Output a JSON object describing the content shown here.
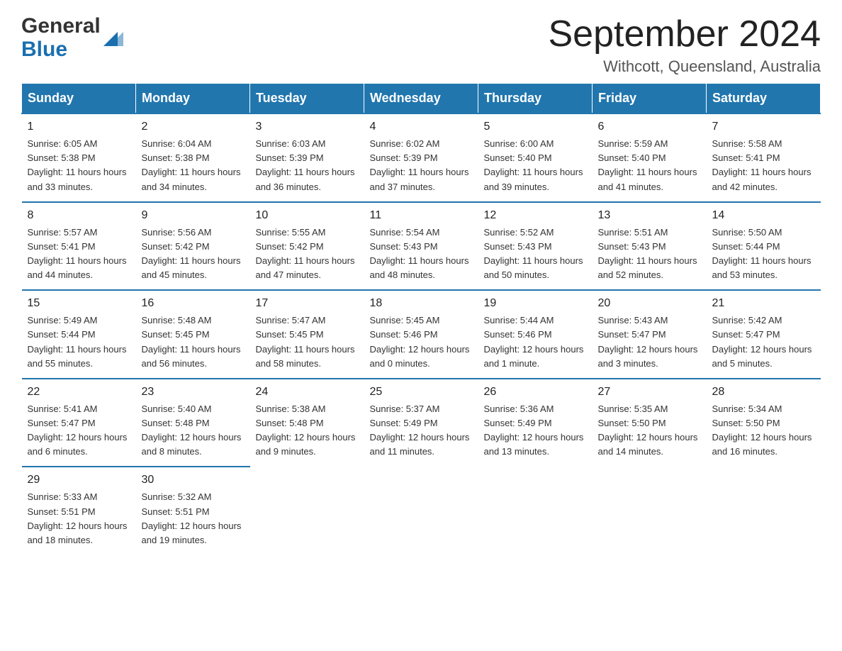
{
  "logo": {
    "general": "General",
    "blue": "Blue"
  },
  "title": "September 2024",
  "subtitle": "Withcott, Queensland, Australia",
  "weekdays": [
    "Sunday",
    "Monday",
    "Tuesday",
    "Wednesday",
    "Thursday",
    "Friday",
    "Saturday"
  ],
  "weeks": [
    [
      {
        "day": "1",
        "sunrise": "6:05 AM",
        "sunset": "5:38 PM",
        "daylight": "11 hours and 33 minutes."
      },
      {
        "day": "2",
        "sunrise": "6:04 AM",
        "sunset": "5:38 PM",
        "daylight": "11 hours and 34 minutes."
      },
      {
        "day": "3",
        "sunrise": "6:03 AM",
        "sunset": "5:39 PM",
        "daylight": "11 hours and 36 minutes."
      },
      {
        "day": "4",
        "sunrise": "6:02 AM",
        "sunset": "5:39 PM",
        "daylight": "11 hours and 37 minutes."
      },
      {
        "day": "5",
        "sunrise": "6:00 AM",
        "sunset": "5:40 PM",
        "daylight": "11 hours and 39 minutes."
      },
      {
        "day": "6",
        "sunrise": "5:59 AM",
        "sunset": "5:40 PM",
        "daylight": "11 hours and 41 minutes."
      },
      {
        "day": "7",
        "sunrise": "5:58 AM",
        "sunset": "5:41 PM",
        "daylight": "11 hours and 42 minutes."
      }
    ],
    [
      {
        "day": "8",
        "sunrise": "5:57 AM",
        "sunset": "5:41 PM",
        "daylight": "11 hours and 44 minutes."
      },
      {
        "day": "9",
        "sunrise": "5:56 AM",
        "sunset": "5:42 PM",
        "daylight": "11 hours and 45 minutes."
      },
      {
        "day": "10",
        "sunrise": "5:55 AM",
        "sunset": "5:42 PM",
        "daylight": "11 hours and 47 minutes."
      },
      {
        "day": "11",
        "sunrise": "5:54 AM",
        "sunset": "5:43 PM",
        "daylight": "11 hours and 48 minutes."
      },
      {
        "day": "12",
        "sunrise": "5:52 AM",
        "sunset": "5:43 PM",
        "daylight": "11 hours and 50 minutes."
      },
      {
        "day": "13",
        "sunrise": "5:51 AM",
        "sunset": "5:43 PM",
        "daylight": "11 hours and 52 minutes."
      },
      {
        "day": "14",
        "sunrise": "5:50 AM",
        "sunset": "5:44 PM",
        "daylight": "11 hours and 53 minutes."
      }
    ],
    [
      {
        "day": "15",
        "sunrise": "5:49 AM",
        "sunset": "5:44 PM",
        "daylight": "11 hours and 55 minutes."
      },
      {
        "day": "16",
        "sunrise": "5:48 AM",
        "sunset": "5:45 PM",
        "daylight": "11 hours and 56 minutes."
      },
      {
        "day": "17",
        "sunrise": "5:47 AM",
        "sunset": "5:45 PM",
        "daylight": "11 hours and 58 minutes."
      },
      {
        "day": "18",
        "sunrise": "5:45 AM",
        "sunset": "5:46 PM",
        "daylight": "12 hours and 0 minutes."
      },
      {
        "day": "19",
        "sunrise": "5:44 AM",
        "sunset": "5:46 PM",
        "daylight": "12 hours and 1 minute."
      },
      {
        "day": "20",
        "sunrise": "5:43 AM",
        "sunset": "5:47 PM",
        "daylight": "12 hours and 3 minutes."
      },
      {
        "day": "21",
        "sunrise": "5:42 AM",
        "sunset": "5:47 PM",
        "daylight": "12 hours and 5 minutes."
      }
    ],
    [
      {
        "day": "22",
        "sunrise": "5:41 AM",
        "sunset": "5:47 PM",
        "daylight": "12 hours and 6 minutes."
      },
      {
        "day": "23",
        "sunrise": "5:40 AM",
        "sunset": "5:48 PM",
        "daylight": "12 hours and 8 minutes."
      },
      {
        "day": "24",
        "sunrise": "5:38 AM",
        "sunset": "5:48 PM",
        "daylight": "12 hours and 9 minutes."
      },
      {
        "day": "25",
        "sunrise": "5:37 AM",
        "sunset": "5:49 PM",
        "daylight": "12 hours and 11 minutes."
      },
      {
        "day": "26",
        "sunrise": "5:36 AM",
        "sunset": "5:49 PM",
        "daylight": "12 hours and 13 minutes."
      },
      {
        "day": "27",
        "sunrise": "5:35 AM",
        "sunset": "5:50 PM",
        "daylight": "12 hours and 14 minutes."
      },
      {
        "day": "28",
        "sunrise": "5:34 AM",
        "sunset": "5:50 PM",
        "daylight": "12 hours and 16 minutes."
      }
    ],
    [
      {
        "day": "29",
        "sunrise": "5:33 AM",
        "sunset": "5:51 PM",
        "daylight": "12 hours and 18 minutes."
      },
      {
        "day": "30",
        "sunrise": "5:32 AM",
        "sunset": "5:51 PM",
        "daylight": "12 hours and 19 minutes."
      },
      null,
      null,
      null,
      null,
      null
    ]
  ],
  "labels": {
    "sunrise": "Sunrise:",
    "sunset": "Sunset:",
    "daylight": "Daylight:"
  }
}
